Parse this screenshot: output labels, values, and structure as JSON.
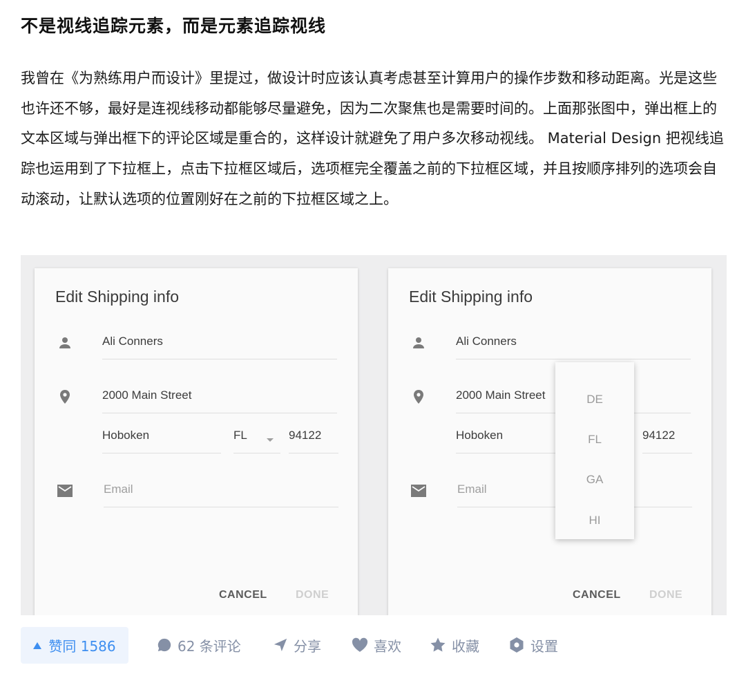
{
  "article": {
    "title": "不是视线追踪元素，而是元素追踪视线",
    "paragraph": "我曾在《为熟练用户而设计》里提过，做设计时应该认真考虑甚至计算用户的操作步数和移动距离。光是这些也许还不够，最好是连视线移动都能够尽量避免，因为二次聚焦也是需要时间的。上面那张图中，弹出框上的文本区域与弹出框下的评论区域是重合的，这样设计就避免了用户多次移动视线。 Material Design 把视线追踪也运用到了下拉框上，点击下拉框区域后，选项框完全覆盖之前的下拉框区域，并且按顺序排列的选项会自动滚动，让默认选项的位置刚好在之前的下拉框区域之上。"
  },
  "figure": {
    "left_card": {
      "title": "Edit Shipping info",
      "name": "Ali Conners",
      "street": "2000 Main Street",
      "city": "Hoboken",
      "state": "FL",
      "zip": "94122",
      "email_placeholder": "Email",
      "cancel": "CANCEL",
      "done": "DONE"
    },
    "right_card": {
      "title": "Edit Shipping info",
      "name": "Ali Conners",
      "street": "2000 Main Street",
      "city": "Hoboken",
      "zip": "94122",
      "email_placeholder": "Email",
      "cancel": "CANCEL",
      "done": "DONE",
      "menu_options": [
        "DE",
        "FL",
        "GA",
        "HI"
      ]
    }
  },
  "actions": {
    "vote": "赞同 1586",
    "comments": "62 条评论",
    "share": "分享",
    "like": "喜欢",
    "favorite": "收藏",
    "settings": "设置"
  },
  "colors": {
    "accent": "#3d8ef0",
    "muted": "#8590a6",
    "vote_bg": "#eef4fd"
  },
  "icons": [
    "person-icon",
    "location-icon",
    "mail-icon",
    "comment-icon",
    "share-icon",
    "heart-icon",
    "star-icon",
    "gear-icon"
  ]
}
